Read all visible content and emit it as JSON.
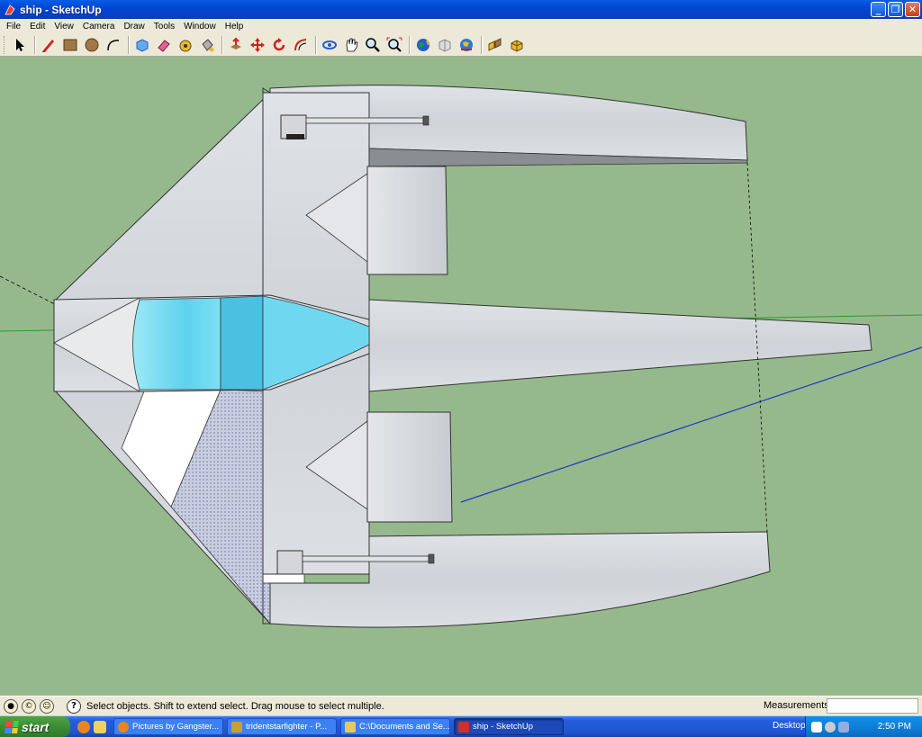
{
  "window": {
    "title": "ship - SketchUp",
    "buttons": [
      "_",
      "❐",
      "✕"
    ]
  },
  "menu": [
    "File",
    "Edit",
    "View",
    "Camera",
    "Draw",
    "Tools",
    "Window",
    "Help"
  ],
  "toolbar": {
    "tools": [
      {
        "name": "select-tool",
        "icon": "arrow-cursor-icon"
      },
      {
        "name": "pencil-tool",
        "icon": "pencil-icon"
      },
      {
        "name": "rectangle-tool",
        "icon": "rectangle-icon"
      },
      {
        "name": "circle-tool",
        "icon": "circle-icon"
      },
      {
        "name": "arc-tool",
        "icon": "arc-icon"
      },
      {
        "name": "make-component-tool",
        "icon": "component-icon"
      },
      {
        "name": "eraser-tool",
        "icon": "eraser-icon"
      },
      {
        "name": "tape-measure-tool",
        "icon": "tape-icon"
      },
      {
        "name": "paint-bucket-tool",
        "icon": "paint-bucket-icon"
      },
      {
        "name": "push-pull-tool",
        "icon": "push-pull-icon"
      },
      {
        "name": "move-tool",
        "icon": "move-icon"
      },
      {
        "name": "rotate-tool",
        "icon": "rotate-icon"
      },
      {
        "name": "offset-tool",
        "icon": "offset-icon"
      },
      {
        "name": "orbit-tool",
        "icon": "orbit-icon"
      },
      {
        "name": "pan-tool",
        "icon": "hand-icon"
      },
      {
        "name": "zoom-tool",
        "icon": "magnifier-icon"
      },
      {
        "name": "zoom-extents-tool",
        "icon": "zoom-extents-icon"
      },
      {
        "name": "get-models-tool",
        "icon": "globe-icon"
      },
      {
        "name": "share-model-tool",
        "icon": "share-icon"
      },
      {
        "name": "place-model-tool",
        "icon": "earth-icon"
      },
      {
        "name": "components-tool",
        "icon": "boxes-icon"
      },
      {
        "name": "warehouse-tool",
        "icon": "cubes-icon"
      }
    ],
    "colors": {
      "red": "#d22020",
      "blue": "#1e5fd0",
      "brown": "#8b5a2b",
      "yellow": "#e8b830",
      "green": "#2a9a2a",
      "pink": "#e0609a"
    }
  },
  "viewport": {
    "background": "#95b98c",
    "model": "ship"
  },
  "status": {
    "icons": [
      "geo-location-icon",
      "credits-icon",
      "user-icon"
    ],
    "help_icon": "?",
    "text": "Select objects. Shift to extend select. Drag mouse to select multiple.",
    "measurements_label": "Measurements",
    "measurements_value": ""
  },
  "taskbar": {
    "start_label": "start",
    "tasks": [
      {
        "label": "Pictures by Gangster...",
        "color": "#e8861a"
      },
      {
        "label": "tridentstarfighter - P...",
        "color": "#c8a030"
      },
      {
        "label": "C:\\Documents and Se...",
        "color": "#e8c860"
      },
      {
        "label": "ship - SketchUp",
        "color": "#d03020",
        "active": true
      }
    ],
    "desktop_label": "Desktop",
    "clock": "2:50 PM"
  }
}
